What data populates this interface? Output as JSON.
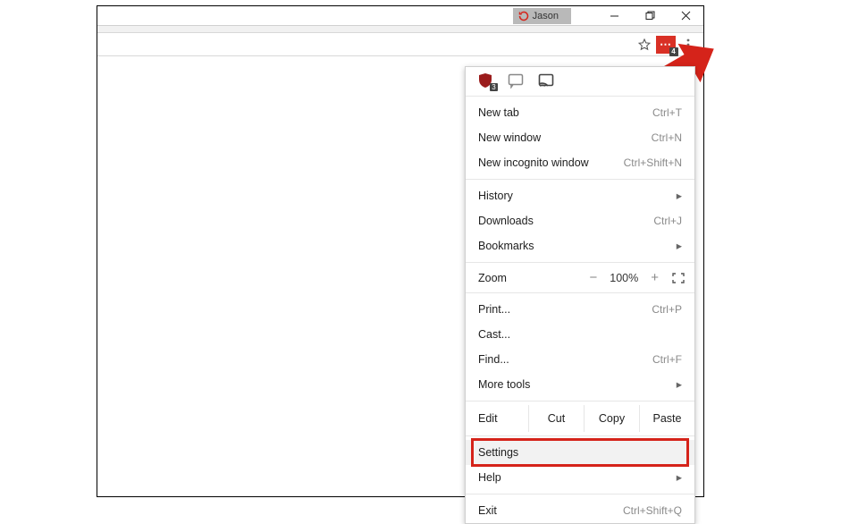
{
  "titlebar": {
    "profile": {
      "name": "Jason"
    }
  },
  "toolbar": {
    "ext_badge": "4"
  },
  "menu": {
    "icons": {
      "shield_badge": "3"
    },
    "new_tab": {
      "label": "New tab",
      "shortcut": "Ctrl+T"
    },
    "new_window": {
      "label": "New window",
      "shortcut": "Ctrl+N"
    },
    "incognito": {
      "label": "New incognito window",
      "shortcut": "Ctrl+Shift+N"
    },
    "history": {
      "label": "History"
    },
    "downloads": {
      "label": "Downloads",
      "shortcut": "Ctrl+J"
    },
    "bookmarks": {
      "label": "Bookmarks"
    },
    "zoom": {
      "label": "Zoom",
      "minus": "−",
      "value": "100%",
      "plus": "+"
    },
    "print": {
      "label": "Print...",
      "shortcut": "Ctrl+P"
    },
    "cast": {
      "label": "Cast..."
    },
    "find": {
      "label": "Find...",
      "shortcut": "Ctrl+F"
    },
    "more_tools": {
      "label": "More tools"
    },
    "edit": {
      "label": "Edit",
      "cut": "Cut",
      "copy": "Copy",
      "paste": "Paste"
    },
    "settings": {
      "label": "Settings"
    },
    "help": {
      "label": "Help"
    },
    "exit": {
      "label": "Exit",
      "shortcut": "Ctrl+Shift+Q"
    }
  }
}
